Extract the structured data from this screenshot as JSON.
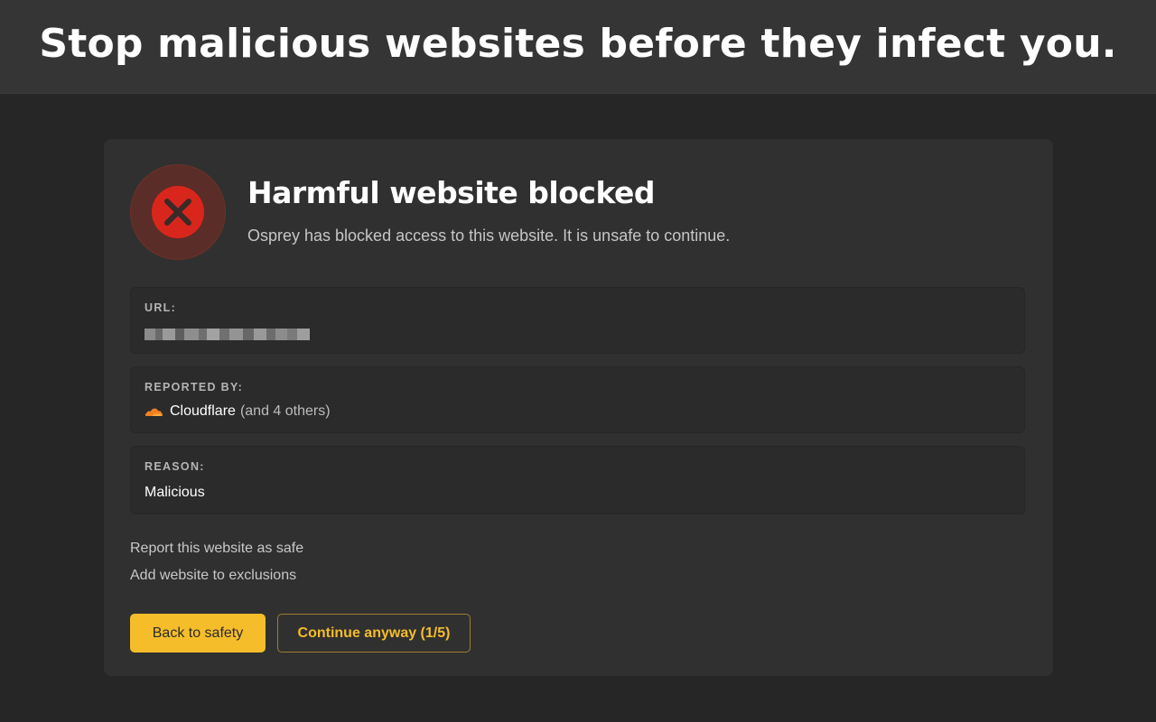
{
  "banner": {
    "headline": "Stop malicious websites before they infect you."
  },
  "warning": {
    "icon": "error-x-icon",
    "title": "Harmful website blocked",
    "subtitle": "Osprey has blocked access to this website. It is unsafe to continue."
  },
  "details": {
    "url": {
      "label": "URL:",
      "value_state": "pixelated"
    },
    "reported_by": {
      "label": "REPORTED BY:",
      "provider": "Cloudflare",
      "others": "(and 4 others)",
      "icon": "cloudflare-icon"
    },
    "reason": {
      "label": "REASON:",
      "value": "Malicious"
    }
  },
  "links": {
    "report_safe": "Report this website as safe",
    "add_exclusion": "Add website to exclusions"
  },
  "actions": {
    "back_label": "Back to safety",
    "continue_label": "Continue anyway (1/5)"
  },
  "colors": {
    "accent": "#f5bd2a",
    "danger": "#d9261c",
    "cloudflare": "#f48120"
  }
}
